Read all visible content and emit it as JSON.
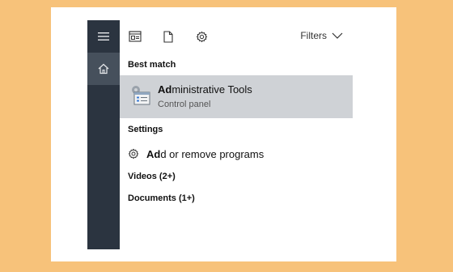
{
  "search_panel": {
    "filters_label": "Filters",
    "sections": {
      "best_match_header": "Best match",
      "settings_header": "Settings",
      "videos_header": "Videos (2+)",
      "documents_header": "Documents (1+)"
    },
    "best_match": {
      "title_bold": "Ad",
      "title_rest": "ministrative Tools",
      "subtitle": "Control panel",
      "icon": "admin-tools-icon"
    },
    "settings_item": {
      "label_bold": "Ad",
      "label_rest": "d or remove programs",
      "icon": "gear-icon"
    }
  },
  "rail": {
    "items": [
      "menu-icon",
      "home-icon"
    ]
  },
  "topbar": {
    "icons": [
      "apps-icon",
      "document-icon",
      "settings-gear-icon"
    ]
  },
  "colors": {
    "background": "#f7c27a",
    "rail": "#2b3440",
    "rail_active": "#46505c",
    "selected_row": "#cfd2d6"
  }
}
